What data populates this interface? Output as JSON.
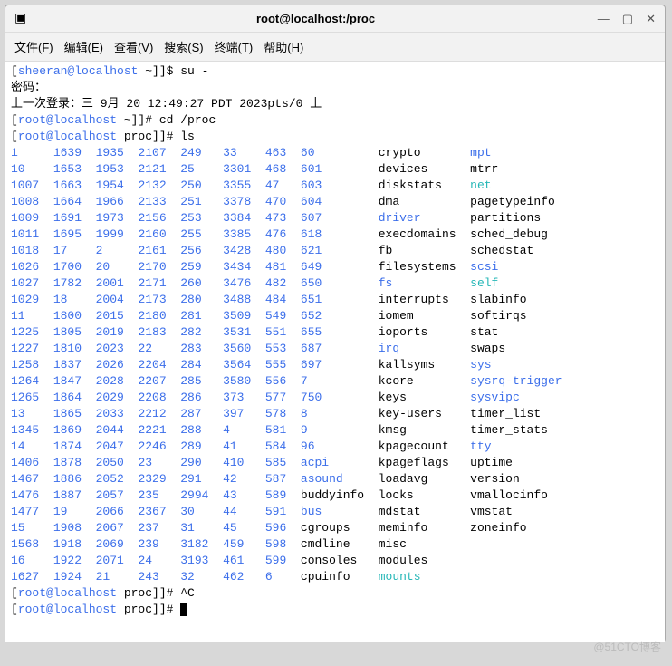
{
  "window": {
    "title": "root@localhost:/proc"
  },
  "menu": [
    "文件(F)",
    "编辑(E)",
    "查看(V)",
    "搜索(S)",
    "终端(T)",
    "帮助(H)"
  ],
  "lines": {
    "l1_user": "sheeran@localhost",
    "l1_tilde": " ~",
    "l1_rest": "]$ su -",
    "l2": "密码：",
    "l3": "上一次登录：三 9月 20 12:49:27 PDT 2023pts/0 上",
    "l4_user": "root@localhost",
    "l4_t": " ~",
    "l4_r": "]# cd /proc",
    "l5_user": "root@localhost",
    "l5_t": " proc",
    "l5_r": "]# ls",
    "l6_user": "root@localhost",
    "l6_t": " proc",
    "l6_r": "]# ^C",
    "l7_user": "root@localhost",
    "l7_t": " proc",
    "l7_r": "]# "
  },
  "rows": [
    [
      [
        "b",
        "1   "
      ],
      [
        "b",
        "  1639"
      ],
      [
        "b",
        "  1935"
      ],
      [
        "b",
        "  2107"
      ],
      [
        "b",
        "  249 "
      ],
      [
        "b",
        "  33  "
      ],
      [
        "b",
        "  463"
      ],
      [
        "b",
        "  60       "
      ],
      [
        "n",
        "  crypto     "
      ],
      [
        "b",
        "  mpt"
      ]
    ],
    [
      [
        "b",
        "10  "
      ],
      [
        "b",
        "  1653"
      ],
      [
        "b",
        "  1953"
      ],
      [
        "b",
        "  2121"
      ],
      [
        "b",
        "  25  "
      ],
      [
        "b",
        "  3301"
      ],
      [
        "b",
        "  468"
      ],
      [
        "b",
        "  601      "
      ],
      [
        "n",
        "  devices    "
      ],
      [
        "n",
        "  mtrr"
      ]
    ],
    [
      [
        "b",
        "1007"
      ],
      [
        "b",
        "  1663"
      ],
      [
        "b",
        "  1954"
      ],
      [
        "b",
        "  2132"
      ],
      [
        "b",
        "  250 "
      ],
      [
        "b",
        "  3355"
      ],
      [
        "b",
        "  47 "
      ],
      [
        "b",
        "  603      "
      ],
      [
        "n",
        "  diskstats  "
      ],
      [
        "c",
        "  net"
      ]
    ],
    [
      [
        "b",
        "1008"
      ],
      [
        "b",
        "  1664"
      ],
      [
        "b",
        "  1966"
      ],
      [
        "b",
        "  2133"
      ],
      [
        "b",
        "  251 "
      ],
      [
        "b",
        "  3378"
      ],
      [
        "b",
        "  470"
      ],
      [
        "b",
        "  604      "
      ],
      [
        "n",
        "  dma        "
      ],
      [
        "n",
        "  pagetypeinfo"
      ]
    ],
    [
      [
        "b",
        "1009"
      ],
      [
        "b",
        "  1691"
      ],
      [
        "b",
        "  1973"
      ],
      [
        "b",
        "  2156"
      ],
      [
        "b",
        "  253 "
      ],
      [
        "b",
        "  3384"
      ],
      [
        "b",
        "  473"
      ],
      [
        "b",
        "  607      "
      ],
      [
        "b",
        "  driver     "
      ],
      [
        "n",
        "  partitions"
      ]
    ],
    [
      [
        "b",
        "1011"
      ],
      [
        "b",
        "  1695"
      ],
      [
        "b",
        "  1999"
      ],
      [
        "b",
        "  2160"
      ],
      [
        "b",
        "  255 "
      ],
      [
        "b",
        "  3385"
      ],
      [
        "b",
        "  476"
      ],
      [
        "b",
        "  618      "
      ],
      [
        "n",
        "  execdomains"
      ],
      [
        "n",
        "  sched_debug"
      ]
    ],
    [
      [
        "b",
        "1018"
      ],
      [
        "b",
        "  17  "
      ],
      [
        "b",
        "  2   "
      ],
      [
        "b",
        "  2161"
      ],
      [
        "b",
        "  256 "
      ],
      [
        "b",
        "  3428"
      ],
      [
        "b",
        "  480"
      ],
      [
        "b",
        "  621      "
      ],
      [
        "n",
        "  fb         "
      ],
      [
        "n",
        "  schedstat"
      ]
    ],
    [
      [
        "b",
        "1026"
      ],
      [
        "b",
        "  1700"
      ],
      [
        "b",
        "  20  "
      ],
      [
        "b",
        "  2170"
      ],
      [
        "b",
        "  259 "
      ],
      [
        "b",
        "  3434"
      ],
      [
        "b",
        "  481"
      ],
      [
        "b",
        "  649      "
      ],
      [
        "n",
        "  filesystems"
      ],
      [
        "b",
        "  scsi"
      ]
    ],
    [
      [
        "b",
        "1027"
      ],
      [
        "b",
        "  1782"
      ],
      [
        "b",
        "  2001"
      ],
      [
        "b",
        "  2171"
      ],
      [
        "b",
        "  260 "
      ],
      [
        "b",
        "  3476"
      ],
      [
        "b",
        "  482"
      ],
      [
        "b",
        "  650      "
      ],
      [
        "b",
        "  fs         "
      ],
      [
        "c",
        "  self"
      ]
    ],
    [
      [
        "b",
        "1029"
      ],
      [
        "b",
        "  18  "
      ],
      [
        "b",
        "  2004"
      ],
      [
        "b",
        "  2173"
      ],
      [
        "b",
        "  280 "
      ],
      [
        "b",
        "  3488"
      ],
      [
        "b",
        "  484"
      ],
      [
        "b",
        "  651      "
      ],
      [
        "n",
        "  interrupts "
      ],
      [
        "n",
        "  slabinfo"
      ]
    ],
    [
      [
        "b",
        "11  "
      ],
      [
        "b",
        "  1800"
      ],
      [
        "b",
        "  2015"
      ],
      [
        "b",
        "  2180"
      ],
      [
        "b",
        "  281 "
      ],
      [
        "b",
        "  3509"
      ],
      [
        "b",
        "  549"
      ],
      [
        "b",
        "  652      "
      ],
      [
        "n",
        "  iomem      "
      ],
      [
        "n",
        "  softirqs"
      ]
    ],
    [
      [
        "b",
        "1225"
      ],
      [
        "b",
        "  1805"
      ],
      [
        "b",
        "  2019"
      ],
      [
        "b",
        "  2183"
      ],
      [
        "b",
        "  282 "
      ],
      [
        "b",
        "  3531"
      ],
      [
        "b",
        "  551"
      ],
      [
        "b",
        "  655      "
      ],
      [
        "n",
        "  ioports    "
      ],
      [
        "n",
        "  stat"
      ]
    ],
    [
      [
        "b",
        "1227"
      ],
      [
        "b",
        "  1810"
      ],
      [
        "b",
        "  2023"
      ],
      [
        "b",
        "  22  "
      ],
      [
        "b",
        "  283 "
      ],
      [
        "b",
        "  3560"
      ],
      [
        "b",
        "  553"
      ],
      [
        "b",
        "  687      "
      ],
      [
        "b",
        "  irq        "
      ],
      [
        "n",
        "  swaps"
      ]
    ],
    [
      [
        "b",
        "1258"
      ],
      [
        "b",
        "  1837"
      ],
      [
        "b",
        "  2026"
      ],
      [
        "b",
        "  2204"
      ],
      [
        "b",
        "  284 "
      ],
      [
        "b",
        "  3564"
      ],
      [
        "b",
        "  555"
      ],
      [
        "b",
        "  697      "
      ],
      [
        "n",
        "  kallsyms   "
      ],
      [
        "b",
        "  sys"
      ]
    ],
    [
      [
        "b",
        "1264"
      ],
      [
        "b",
        "  1847"
      ],
      [
        "b",
        "  2028"
      ],
      [
        "b",
        "  2207"
      ],
      [
        "b",
        "  285 "
      ],
      [
        "b",
        "  3580"
      ],
      [
        "b",
        "  556"
      ],
      [
        "b",
        "  7        "
      ],
      [
        "n",
        "  kcore      "
      ],
      [
        "b",
        "  sysrq-trigger"
      ]
    ],
    [
      [
        "b",
        "1265"
      ],
      [
        "b",
        "  1864"
      ],
      [
        "b",
        "  2029"
      ],
      [
        "b",
        "  2208"
      ],
      [
        "b",
        "  286 "
      ],
      [
        "b",
        "  373 "
      ],
      [
        "b",
        "  577"
      ],
      [
        "b",
        "  750      "
      ],
      [
        "n",
        "  keys       "
      ],
      [
        "b",
        "  sysvipc"
      ]
    ],
    [
      [
        "b",
        "13  "
      ],
      [
        "b",
        "  1865"
      ],
      [
        "b",
        "  2033"
      ],
      [
        "b",
        "  2212"
      ],
      [
        "b",
        "  287 "
      ],
      [
        "b",
        "  397 "
      ],
      [
        "b",
        "  578"
      ],
      [
        "b",
        "  8        "
      ],
      [
        "n",
        "  key-users  "
      ],
      [
        "n",
        "  timer_list"
      ]
    ],
    [
      [
        "b",
        "1345"
      ],
      [
        "b",
        "  1869"
      ],
      [
        "b",
        "  2044"
      ],
      [
        "b",
        "  2221"
      ],
      [
        "b",
        "  288 "
      ],
      [
        "b",
        "  4   "
      ],
      [
        "b",
        "  581"
      ],
      [
        "b",
        "  9        "
      ],
      [
        "n",
        "  kmsg       "
      ],
      [
        "n",
        "  timer_stats"
      ]
    ],
    [
      [
        "b",
        "14  "
      ],
      [
        "b",
        "  1874"
      ],
      [
        "b",
        "  2047"
      ],
      [
        "b",
        "  2246"
      ],
      [
        "b",
        "  289 "
      ],
      [
        "b",
        "  41  "
      ],
      [
        "b",
        "  584"
      ],
      [
        "b",
        "  96       "
      ],
      [
        "n",
        "  kpagecount "
      ],
      [
        "b",
        "  tty"
      ]
    ],
    [
      [
        "b",
        "1406"
      ],
      [
        "b",
        "  1878"
      ],
      [
        "b",
        "  2050"
      ],
      [
        "b",
        "  23  "
      ],
      [
        "b",
        "  290 "
      ],
      [
        "b",
        "  410 "
      ],
      [
        "b",
        "  585"
      ],
      [
        "b",
        "  acpi     "
      ],
      [
        "n",
        "  kpageflags "
      ],
      [
        "n",
        "  uptime"
      ]
    ],
    [
      [
        "b",
        "1467"
      ],
      [
        "b",
        "  1886"
      ],
      [
        "b",
        "  2052"
      ],
      [
        "b",
        "  2329"
      ],
      [
        "b",
        "  291 "
      ],
      [
        "b",
        "  42  "
      ],
      [
        "b",
        "  587"
      ],
      [
        "b",
        "  asound   "
      ],
      [
        "n",
        "  loadavg    "
      ],
      [
        "n",
        "  version"
      ]
    ],
    [
      [
        "b",
        "1476"
      ],
      [
        "b",
        "  1887"
      ],
      [
        "b",
        "  2057"
      ],
      [
        "b",
        "  235 "
      ],
      [
        "b",
        "  2994"
      ],
      [
        "b",
        "  43  "
      ],
      [
        "b",
        "  589"
      ],
      [
        "n",
        "  buddyinfo"
      ],
      [
        "n",
        "  locks      "
      ],
      [
        "n",
        "  vmallocinfo"
      ]
    ],
    [
      [
        "b",
        "1477"
      ],
      [
        "b",
        "  19  "
      ],
      [
        "b",
        "  2066"
      ],
      [
        "b",
        "  2367"
      ],
      [
        "b",
        "  30  "
      ],
      [
        "b",
        "  44  "
      ],
      [
        "b",
        "  591"
      ],
      [
        "b",
        "  bus      "
      ],
      [
        "n",
        "  mdstat     "
      ],
      [
        "n",
        "  vmstat"
      ]
    ],
    [
      [
        "b",
        "15  "
      ],
      [
        "b",
        "  1908"
      ],
      [
        "b",
        "  2067"
      ],
      [
        "b",
        "  237 "
      ],
      [
        "b",
        "  31  "
      ],
      [
        "b",
        "  45  "
      ],
      [
        "b",
        "  596"
      ],
      [
        "n",
        "  cgroups  "
      ],
      [
        "n",
        "  meminfo    "
      ],
      [
        "n",
        "  zoneinfo"
      ]
    ],
    [
      [
        "b",
        "1568"
      ],
      [
        "b",
        "  1918"
      ],
      [
        "b",
        "  2069"
      ],
      [
        "b",
        "  239 "
      ],
      [
        "b",
        "  3182"
      ],
      [
        "b",
        "  459 "
      ],
      [
        "b",
        "  598"
      ],
      [
        "n",
        "  cmdline  "
      ],
      [
        "n",
        "  misc"
      ],
      [
        "n",
        ""
      ]
    ],
    [
      [
        "b",
        "16  "
      ],
      [
        "b",
        "  1922"
      ],
      [
        "b",
        "  2071"
      ],
      [
        "b",
        "  24  "
      ],
      [
        "b",
        "  3193"
      ],
      [
        "b",
        "  461 "
      ],
      [
        "b",
        "  599"
      ],
      [
        "n",
        "  consoles "
      ],
      [
        "n",
        "  modules"
      ],
      [
        "n",
        ""
      ]
    ],
    [
      [
        "b",
        "1627"
      ],
      [
        "b",
        "  1924"
      ],
      [
        "b",
        "  21  "
      ],
      [
        "b",
        "  243 "
      ],
      [
        "b",
        "  32  "
      ],
      [
        "b",
        "  462 "
      ],
      [
        "b",
        "  6  "
      ],
      [
        "n",
        "  cpuinfo  "
      ],
      [
        "c",
        "  mounts"
      ],
      [
        "n",
        ""
      ]
    ]
  ],
  "watermark": "@51CTO博客"
}
